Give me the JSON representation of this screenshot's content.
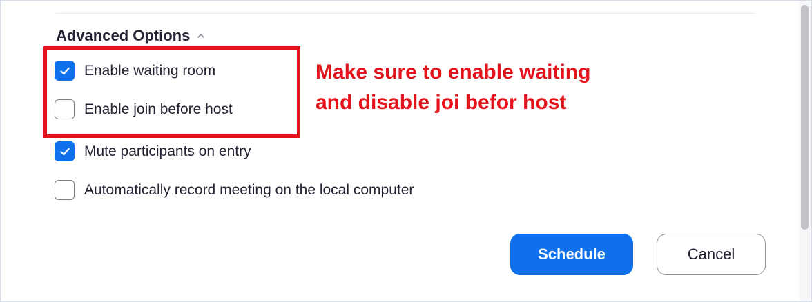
{
  "advanced_options": {
    "title": "Advanced Options",
    "toggle_icon": "chevron-up-icon",
    "options": [
      {
        "label": "Enable waiting room",
        "checked": true
      },
      {
        "label": "Enable join before host",
        "checked": false
      },
      {
        "label": "Mute participants on entry",
        "checked": true
      },
      {
        "label": "Automatically record meeting on the local computer",
        "checked": false
      }
    ]
  },
  "annotation": {
    "line1": "Make sure to enable waiting",
    "line2": "and disable joi befor host",
    "color": "#e3131b"
  },
  "actions": {
    "schedule_label": "Schedule",
    "cancel_label": "Cancel"
  },
  "colors": {
    "accent": "#0e71eb",
    "text": "#232333",
    "annotation_red": "#e3131b"
  }
}
